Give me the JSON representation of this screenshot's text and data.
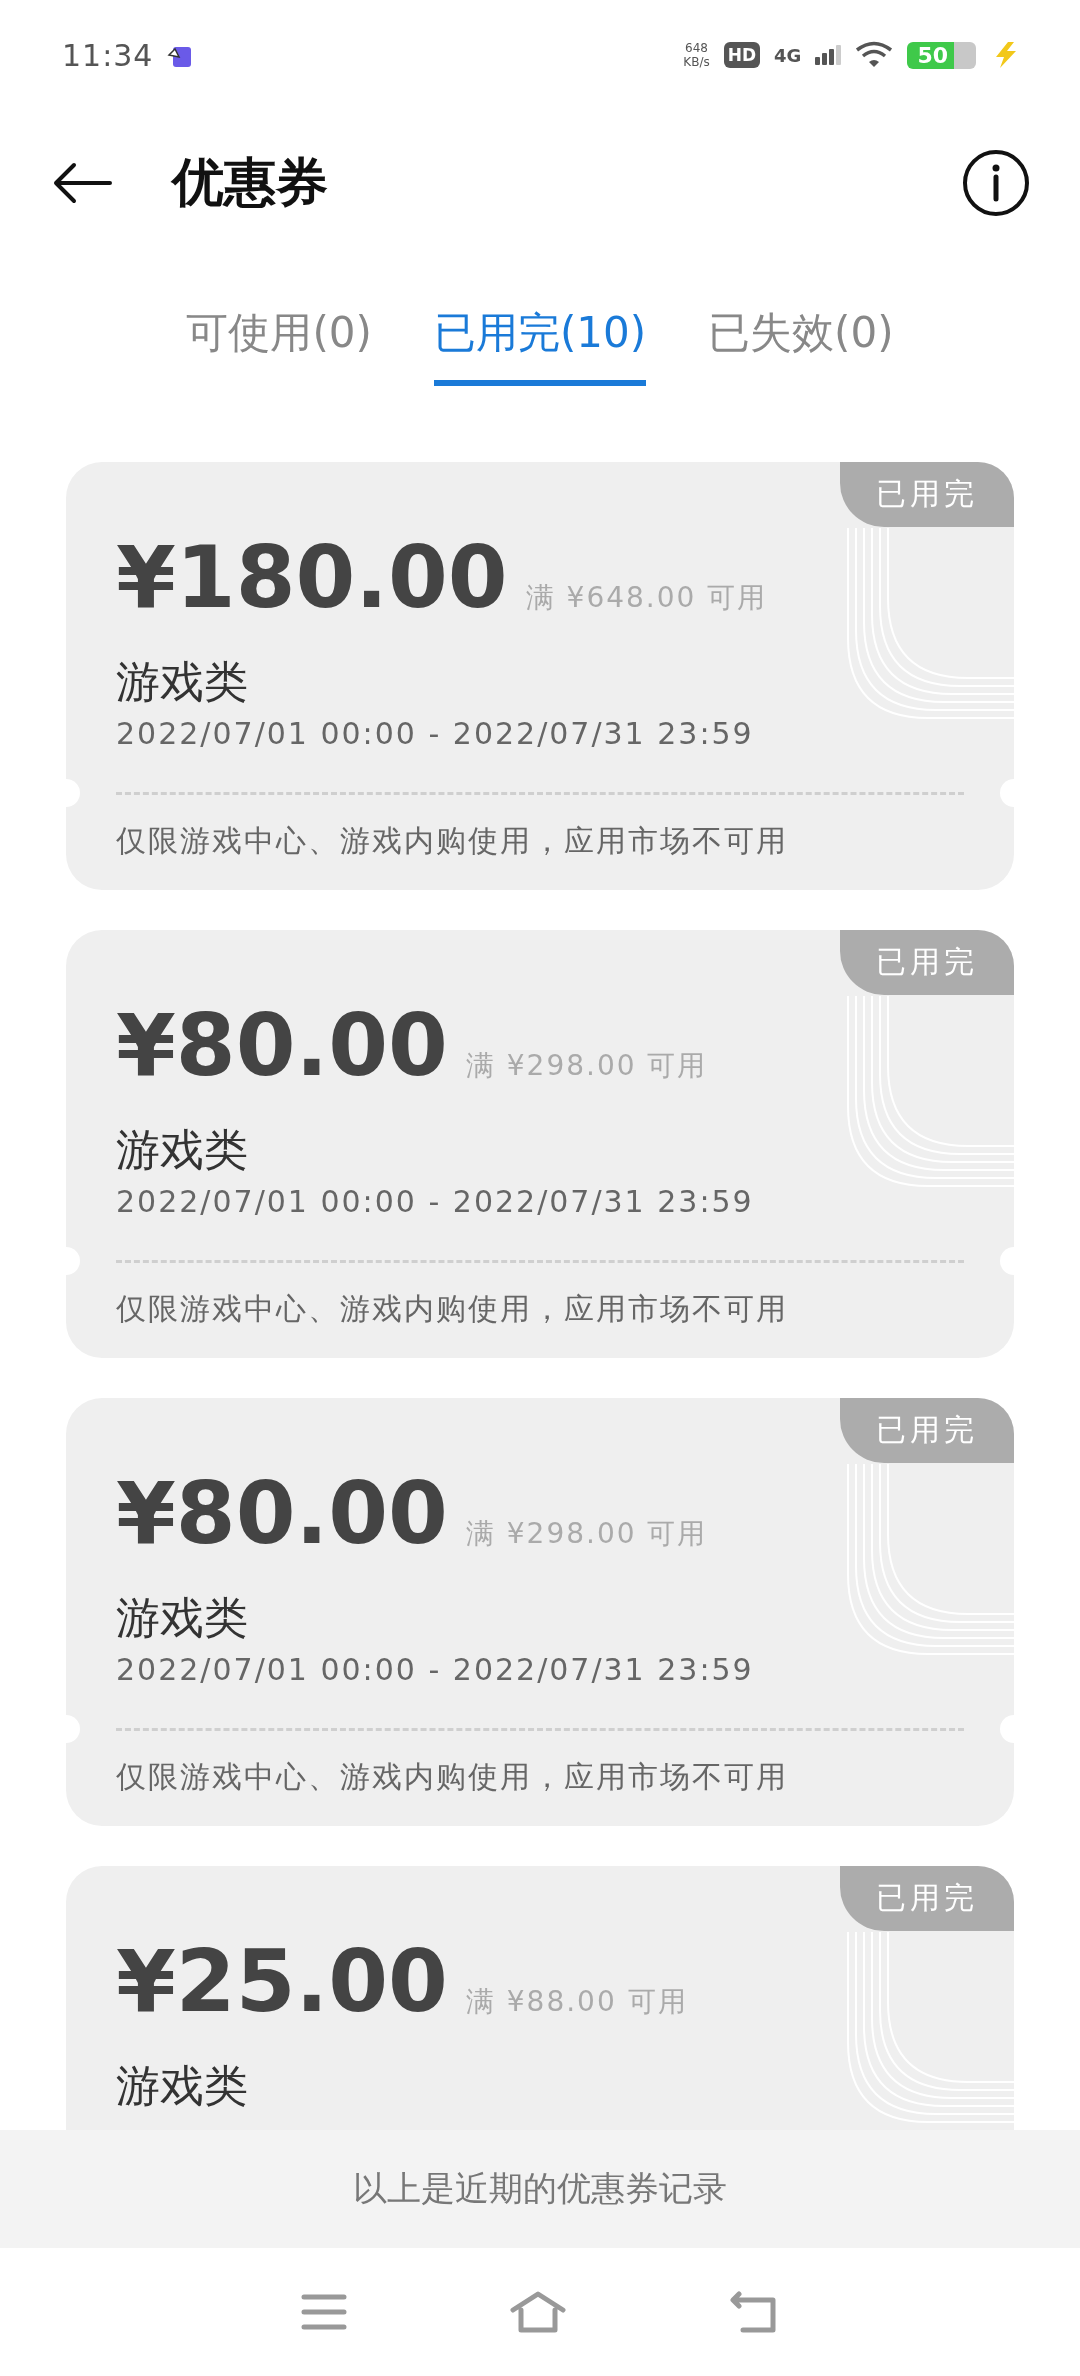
{
  "status_bar": {
    "time": "11:34",
    "net_speed": "648",
    "net_unit": "KB/s",
    "hd": "HD",
    "network": "4G",
    "battery": "50"
  },
  "header": {
    "title": "优惠券"
  },
  "tabs": [
    {
      "label": "可使用(0)",
      "selected": false
    },
    {
      "label": "已用完(10)",
      "selected": true
    },
    {
      "label": "已失效(0)",
      "selected": false
    }
  ],
  "coupons": [
    {
      "amount": "¥180.00",
      "condition": "满 ¥648.00 可用",
      "category": "游戏类",
      "validity": "2022/07/01 00:00 - 2022/07/31 23:59",
      "note": "仅限游戏中心、游戏内购使用，应用市场不可用",
      "stamp": "已用完"
    },
    {
      "amount": "¥80.00",
      "condition": "满 ¥298.00 可用",
      "category": "游戏类",
      "validity": "2022/07/01 00:00 - 2022/07/31 23:59",
      "note": "仅限游戏中心、游戏内购使用，应用市场不可用",
      "stamp": "已用完"
    },
    {
      "amount": "¥80.00",
      "condition": "满 ¥298.00 可用",
      "category": "游戏类",
      "validity": "2022/07/01 00:00 - 2022/07/31 23:59",
      "note": "仅限游戏中心、游戏内购使用，应用市场不可用",
      "stamp": "已用完"
    },
    {
      "amount": "¥25.00",
      "condition": "满 ¥88.00 可用",
      "category": "游戏类",
      "stamp": "已用完"
    }
  ],
  "footer": {
    "text": "以上是近期的优惠券记录"
  }
}
